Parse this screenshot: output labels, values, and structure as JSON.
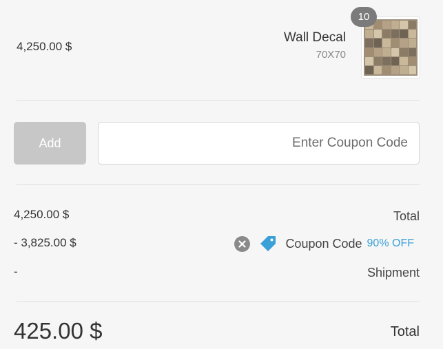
{
  "item": {
    "price": "4,250.00 $",
    "name": "Wall Decal",
    "variant": "70X70",
    "quantity": "10",
    "thumbnail": "wall-decal-letters-image"
  },
  "coupon_form": {
    "add_label": "Add",
    "placeholder": "Enter Coupon Code",
    "value": ""
  },
  "summary": {
    "subtotal_value": "4,250.00 $",
    "subtotal_label": "Total",
    "discount_value": "- 3,825.00 $",
    "coupon_label": "Coupon Code",
    "coupon_off": "90% OFF",
    "shipment_value": "-",
    "shipment_label": "Shipment",
    "grand_total_value": "425.00 $",
    "grand_total_label": "Total"
  },
  "colors": {
    "accent": "#3aa0d8",
    "button_disabled": "#c7c7c7",
    "badge": "#7b7b7b",
    "background": "#f6f6f6"
  }
}
